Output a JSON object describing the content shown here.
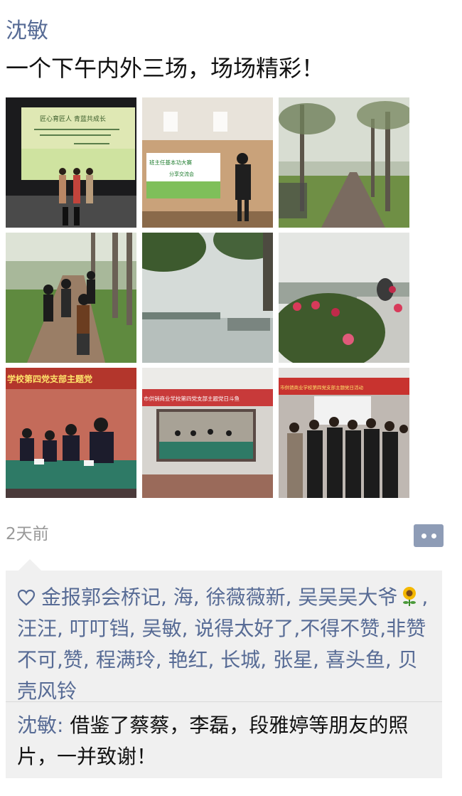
{
  "post": {
    "author": "沈敏",
    "text": "一个下午内外三场，场场精彩！",
    "time": "2天前"
  },
  "photos": [
    {
      "caption_line1": "匠心育匠人 青蓝共成长"
    },
    {
      "caption_line1": "班主任基本功大赛",
      "caption_line2": "分享交流会"
    },
    {},
    {},
    {},
    {},
    {
      "caption_line1": "学校第四党支部主题党"
    },
    {
      "caption_line1": "市供销商业学校第四党支部主题党日斗鱼"
    },
    {
      "caption_line1": "市供销商业学校第四党支部主题党日活动"
    }
  ],
  "likes": {
    "names_before_emoji": "金报郭会桥记, 海, 徐薇薇新, 吴吴吴大爷",
    "names_after_emoji": ", 汪汪, 叮叮铛, 吴敏, 说得太好了,不得不赞,非赞不可,赞, 程满玲, 艳红, 长城, 张星, 喜头鱼, 贝壳风铃"
  },
  "comment": {
    "commenter": "沈敏",
    "separator": ": ",
    "text": "借鉴了蔡蔡，李磊，段雅婷等朋友的照片，一并致谢！"
  },
  "icons": {
    "likes": "heart-outline-icon",
    "emoji": "sunflower-emoji-icon",
    "more_actions": "comment-dots-icon"
  },
  "colors": {
    "name_link": "#576b95",
    "text": "#111111",
    "time": "#999999",
    "like_panel": "#f0f0f0",
    "action_button": "#8e9cb6"
  }
}
